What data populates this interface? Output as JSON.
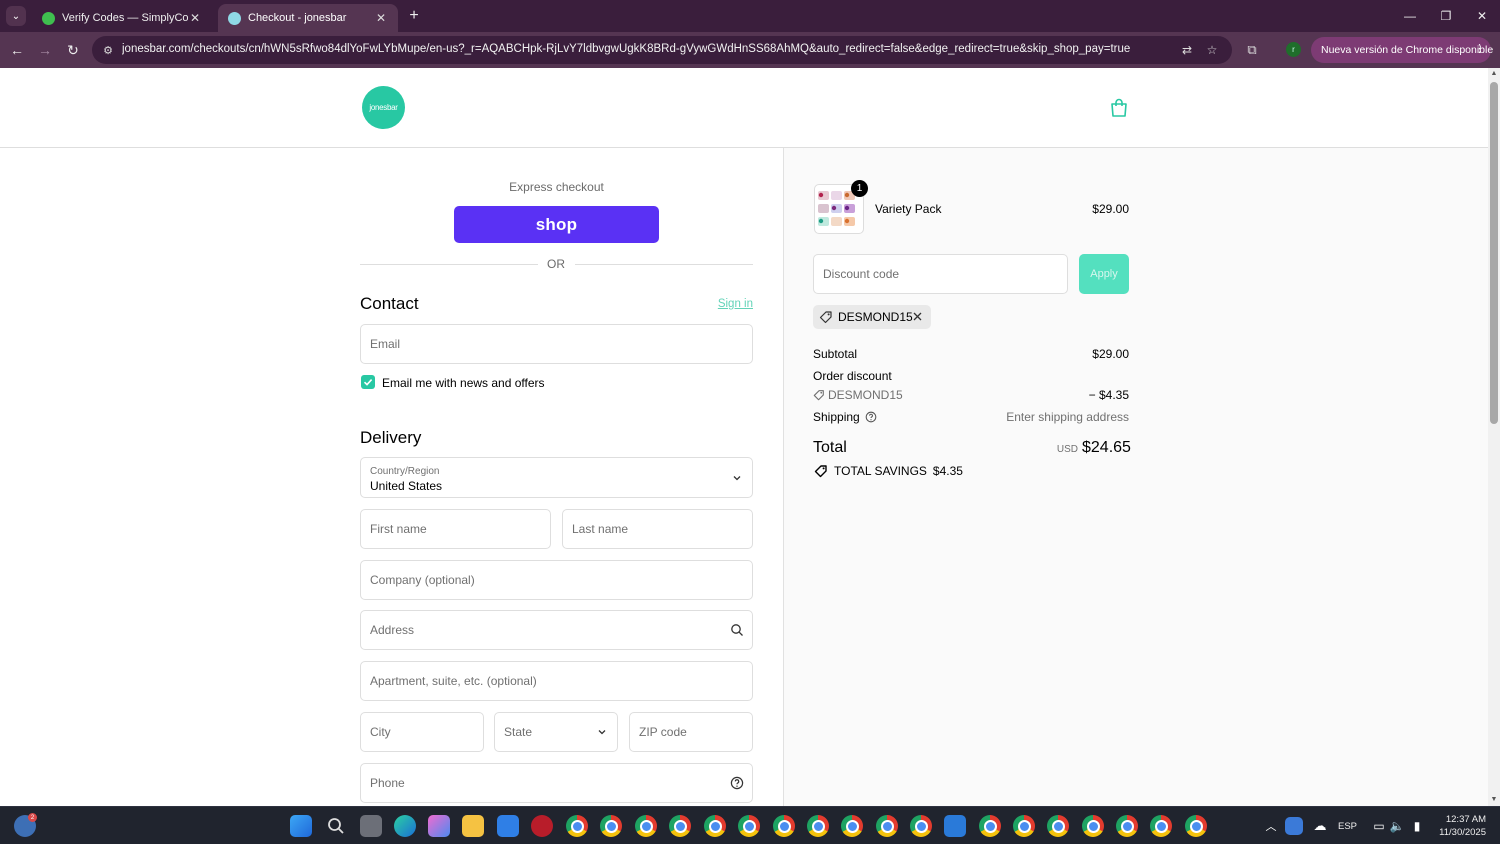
{
  "browser": {
    "tabs": [
      {
        "title": "Verify Codes — SimplyCodes",
        "favicon_color": "#3fbf4f"
      },
      {
        "title": "Checkout - jonesbar",
        "favicon_color": "#28c8a3"
      }
    ],
    "new_tab_glyph": "+",
    "url": "jonesbar.com/checkouts/cn/hWN5sRfwo84dlYoFwLYbMupe/en-us?_r=AQABCHpk-RjLvY7ldbvgwUgkK8BRd-gVywGWdHnSS68AhMQ&auto_redirect=false&edge_redirect=true&skip_shop_pay=true",
    "update_chip": "Nueva versión de Chrome disponible",
    "profile_initial": "r"
  },
  "store": {
    "logo_text": "jonesbar",
    "brand_color": "#28c8a3"
  },
  "checkout": {
    "express_label": "Express checkout",
    "shop_button": "shop",
    "shop_color": "#5a31f4",
    "or_text": "OR",
    "contact_heading": "Contact",
    "sign_in": "Sign in",
    "email_placeholder": "Email",
    "newsletter_label": "Email me with news and offers",
    "newsletter_checked": true,
    "delivery_heading": "Delivery",
    "country_label": "Country/Region",
    "country_value": "United States",
    "first_name": "First name",
    "last_name": "Last name",
    "company": "Company (optional)",
    "address": "Address",
    "apartment": "Apartment, suite, etc. (optional)",
    "city": "City",
    "state": "State",
    "zip": "ZIP code",
    "phone": "Phone"
  },
  "summary": {
    "item_name": "Variety Pack",
    "item_qty": "1",
    "item_price": "$29.00",
    "discount_placeholder": "Discount code",
    "apply_label": "Apply",
    "applied_code": "DESMOND15",
    "subtotal_label": "Subtotal",
    "subtotal_value": "$29.00",
    "order_discount_label": "Order discount",
    "discount_code": "DESMOND15",
    "discount_value": "− $4.35",
    "shipping_label": "Shipping",
    "shipping_value": "Enter shipping address",
    "total_label": "Total",
    "currency": "USD",
    "total_value": "$24.65",
    "savings_label": "TOTAL SAVINGS",
    "savings_value": "$4.35"
  },
  "taskbar": {
    "weather_badge": "2",
    "language": "ESP",
    "time": "12:37 AM",
    "date": "11/30/2025"
  }
}
